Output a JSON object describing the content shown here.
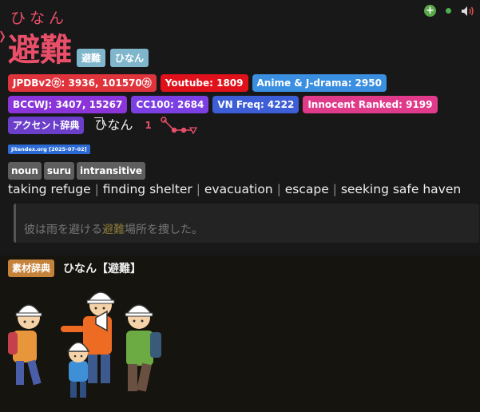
{
  "entry": {
    "reading": "ひなん",
    "headword": "避難",
    "headword_tags": [
      "避難",
      "ひなん"
    ]
  },
  "toolbar": {
    "add_icon": "plus-circle-icon",
    "status_icon": "green-dot-icon",
    "audio_icon": "speaker-icon"
  },
  "frequencies": [
    {
      "label": "JPDBv2㋕: 3936, 101570㋕",
      "color": "#e0343c"
    },
    {
      "label": "Youtube: 1809",
      "color": "#e0111a"
    },
    {
      "label": "Anime & J-drama: 2950",
      "color": "#3b8fe0"
    },
    {
      "label": "BCCWJ: 3407, 15267",
      "color": "#8a34d9"
    },
    {
      "label": "CC100: 2684",
      "color": "#7b3fe4"
    },
    {
      "label": "VN Freq: 4222",
      "color": "#3d5ed6"
    },
    {
      "label": "Innocent Ranked: 9199",
      "color": "#e03a8a"
    }
  ],
  "pitch": {
    "dict_label": "アクセント辞典",
    "dict_color": "#6b3fc9",
    "kana_first": "ひ",
    "kana_rest": "なん",
    "number": "1"
  },
  "definition": {
    "source_label": "Jitendex.org [2025-07-02]",
    "pos_tags": [
      "noun",
      "suru",
      "intransitive"
    ],
    "glosses": [
      "taking refuge",
      "finding shelter",
      "evacuation",
      "escape",
      "seeking safe haven"
    ],
    "example_before": "彼は雨を避ける",
    "example_highlight": "避難",
    "example_after": "場所を捜した。"
  },
  "sozai": {
    "tag": "素材辞典",
    "title": "ひなん【避難】",
    "image_icon": "evacuation-illustration-icon"
  },
  "colors": {
    "accent": "#ea4f6a",
    "background": "#181818"
  }
}
